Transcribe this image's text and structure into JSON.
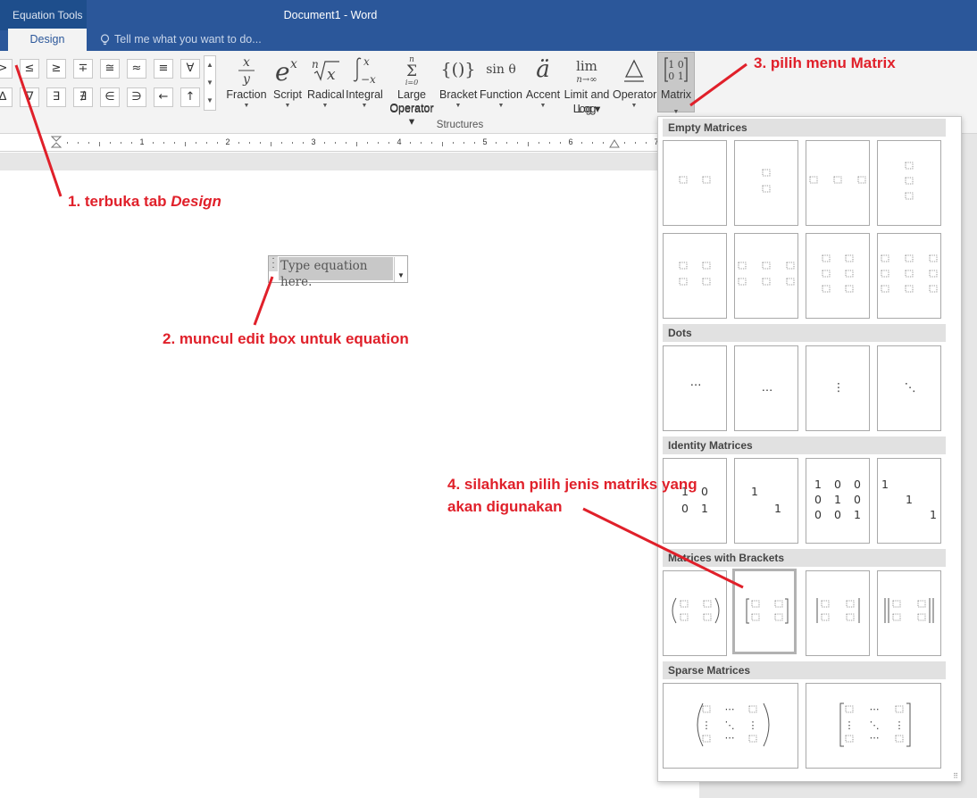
{
  "window": {
    "context_tab": "Equation Tools",
    "title": "Document1 - Word",
    "active_tab": "Design",
    "tell_me": "Tell me what you want to do..."
  },
  "symbols": {
    "row1": [
      ">",
      "≤",
      "≥",
      "∓",
      "≅",
      "≈",
      "≡",
      "∀"
    ],
    "row2": [
      "∆",
      "∇",
      "∃",
      "∄",
      "∈",
      "∋",
      "←",
      "↑"
    ]
  },
  "structures": {
    "group_label": "Structures",
    "items": [
      {
        "id": "fraction",
        "label": "Fraction"
      },
      {
        "id": "script",
        "label": "Script"
      },
      {
        "id": "radical",
        "label": "Radical"
      },
      {
        "id": "integral",
        "label": "Integral"
      },
      {
        "id": "large-operator",
        "label": "Large Operator"
      },
      {
        "id": "bracket",
        "label": "Bracket"
      },
      {
        "id": "function",
        "label": "Function"
      },
      {
        "id": "accent",
        "label": "Accent"
      },
      {
        "id": "limit-and-log",
        "label": "Limit and Log"
      },
      {
        "id": "operator",
        "label": "Operator"
      },
      {
        "id": "matrix",
        "label": "Matrix"
      }
    ]
  },
  "ruler_numbers": [
    "1",
    "2",
    "3",
    "4",
    "5",
    "6",
    "7"
  ],
  "equation": {
    "placeholder": "Type equation here."
  },
  "matrix_gallery": {
    "sections": [
      "Empty Matrices",
      "Dots",
      "Identity Matrices",
      "Matrices with Brackets",
      "Sparse Matrices"
    ]
  },
  "identity": {
    "m2": [
      "1",
      "0",
      "0",
      "1"
    ],
    "m2s": [
      "1",
      "1"
    ],
    "m3": [
      "1",
      "0",
      "0",
      "0",
      "1",
      "0",
      "0",
      "0",
      "1"
    ],
    "m3s": [
      "1",
      "1",
      "1"
    ]
  },
  "annotations": {
    "step1_prefix": "1. terbuka tab ",
    "step1_italic": "Design",
    "step2": "2. muncul edit box untuk equation",
    "step3": "3. pilih menu Matrix",
    "step4_line1": "4. silahkan pilih jenis matriks yang",
    "step4_line2": "akan digunakan",
    "color": "#e0202a"
  }
}
